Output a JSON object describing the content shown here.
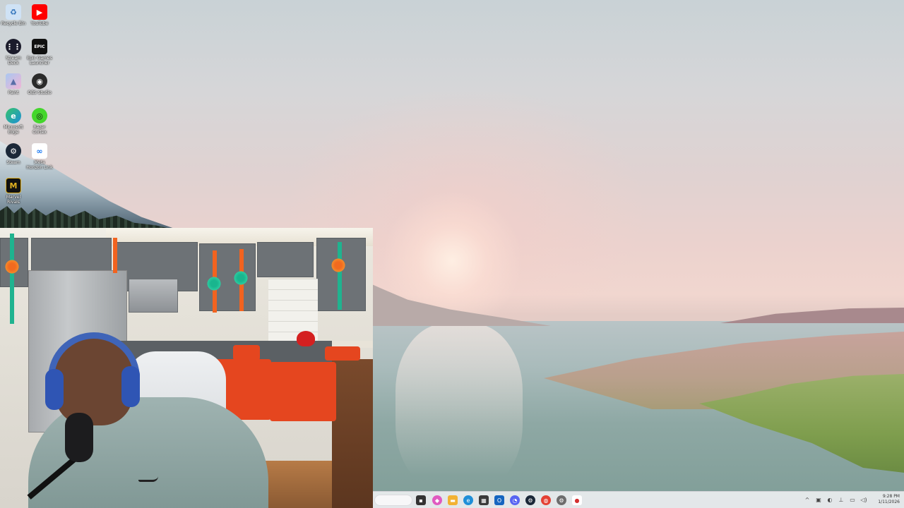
{
  "desktop_icons": [
    {
      "label": "Recycle Bin",
      "icon": "recycle-bin-icon",
      "color": "#cfe2f5"
    },
    {
      "label": "YouTube",
      "icon": "youtube-icon",
      "color": "#ff0000"
    },
    {
      "label": "Stream Deck",
      "icon": "stream-deck-icon",
      "color": "#1b1b2b"
    },
    {
      "label": "Epic Games Launcher",
      "icon": "epic-games-icon",
      "color": "#111111"
    },
    {
      "label": "Paint",
      "icon": "paint-icon",
      "color": "#a9c7f0"
    },
    {
      "label": "OBS Studio",
      "icon": "obs-studio-icon",
      "color": "#2b2b2b"
    },
    {
      "label": "Microsoft Edge",
      "icon": "edge-icon",
      "color": "#1f8fd8"
    },
    {
      "label": "Razer Cortex",
      "icon": "razer-cortex-icon",
      "color": "#44d62c"
    },
    {
      "label": "Steam",
      "icon": "steam-icon",
      "color": "#1b2838"
    },
    {
      "label": "Meta Horizon Link",
      "icon": "meta-icon",
      "color": "#ffffff"
    },
    {
      "label": "Marvel Rivals",
      "icon": "marvel-rivals-icon",
      "color": "#e0b020"
    }
  ],
  "icon_glyphs": {
    "youtube": "▶",
    "stream_deck": "⋮⋮",
    "epic": "EPIC",
    "obs": "◉",
    "edge": "e",
    "razer": "◎",
    "steam": "⚙",
    "meta": "∞",
    "marvel": "M",
    "recycle": "♻",
    "paint": "▲"
  },
  "taskbar": {
    "apps": [
      {
        "name": "file-explorer-icon",
        "glyph": "▪",
        "color": "#333333"
      },
      {
        "name": "copilot-icon",
        "glyph": "◆",
        "color": "#e05ac0"
      },
      {
        "name": "folder-icon",
        "glyph": "▬",
        "color": "#f2b233"
      },
      {
        "name": "edge-icon",
        "glyph": "e",
        "color": "#1f8fd8"
      },
      {
        "name": "calculator-icon",
        "glyph": "▦",
        "color": "#3a3a3a"
      },
      {
        "name": "outlook-icon",
        "glyph": "O",
        "color": "#1565c0"
      },
      {
        "name": "discord-icon",
        "glyph": "◔",
        "color": "#5865f2"
      },
      {
        "name": "steam-icon",
        "glyph": "⚙",
        "color": "#1b2838"
      },
      {
        "name": "chrome-icon",
        "glyph": "◍",
        "color": "#e44134"
      },
      {
        "name": "settings-icon",
        "glyph": "⚙",
        "color": "#6d6d6d"
      },
      {
        "name": "recording-app-icon",
        "glyph": "●",
        "color": "#d32f2f"
      }
    ],
    "tray": [
      {
        "name": "show-hidden-icons",
        "glyph": "^"
      },
      {
        "name": "tray-app-1-icon",
        "glyph": "▣"
      },
      {
        "name": "tray-app-2-icon",
        "glyph": "◐"
      },
      {
        "name": "usb-icon",
        "glyph": "⊥"
      },
      {
        "name": "network-icon",
        "glyph": "▭"
      },
      {
        "name": "volume-icon",
        "glyph": "◁)"
      },
      {
        "name": "battery-icon",
        "glyph": "▯"
      }
    ],
    "clock": {
      "time": "9:28 PM",
      "date": "1/11/2026"
    }
  }
}
